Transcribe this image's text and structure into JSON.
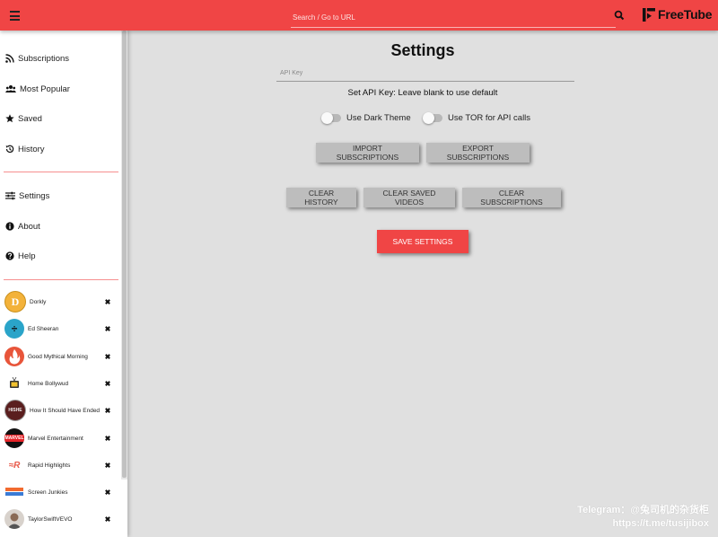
{
  "topbar": {
    "search_placeholder": "Search / Go to URL",
    "logo_text": "FreeTube",
    "accent_color": "#f04545"
  },
  "sidebar": {
    "nav": [
      {
        "label": "Subscriptions",
        "icon": "rss-icon"
      },
      {
        "label": "Most Popular",
        "icon": "users-icon"
      },
      {
        "label": "Saved",
        "icon": "star-icon"
      },
      {
        "label": "History",
        "icon": "history-icon"
      }
    ],
    "nav2": [
      {
        "label": "Settings",
        "icon": "sliders-icon"
      },
      {
        "label": "About",
        "icon": "info-icon"
      },
      {
        "label": "Help",
        "icon": "question-icon"
      }
    ],
    "channels": [
      {
        "name": "Dorkly"
      },
      {
        "name": "Ed Sheeran"
      },
      {
        "name": "Good Mythical Morning"
      },
      {
        "name": "Home Bollywud"
      },
      {
        "name": "How It Should Have Ended"
      },
      {
        "name": "Marvel Entertainment"
      },
      {
        "name": "Rapid Highlights"
      },
      {
        "name": "Screen Junkies"
      },
      {
        "name": "TaylorSwiftVEVO"
      }
    ]
  },
  "settings": {
    "title": "Settings",
    "api_key_placeholder": "API Key",
    "api_key_hint": "Set API Key: Leave blank to use default",
    "dark_theme_label": "Use Dark Theme",
    "dark_theme_on": false,
    "tor_label": "Use TOR for API calls",
    "tor_on": false,
    "import_label": "IMPORT SUBSCRIPTIONS",
    "export_label": "EXPORT SUBSCRIPTIONS",
    "clear_history_label": "CLEAR HISTORY",
    "clear_saved_label": "CLEAR SAVED VIDEOS",
    "clear_subs_label": "CLEAR SUBSCRIPTIONS",
    "save_label": "SAVE SETTINGS"
  },
  "watermark": {
    "line1": "Telegram：@兔司机的杂货柜",
    "line2": "https://t.me/tusijibox"
  }
}
